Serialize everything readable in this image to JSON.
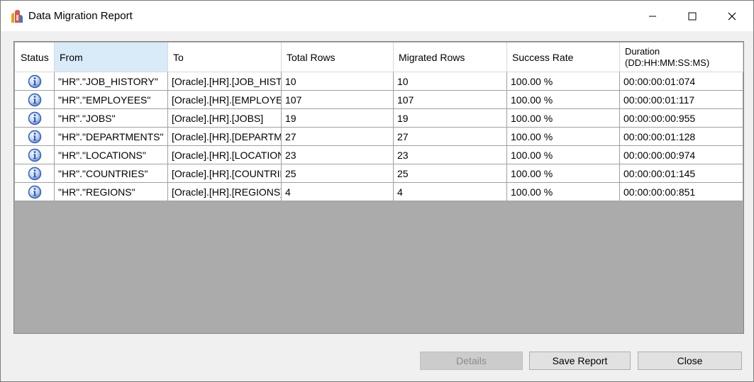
{
  "window": {
    "title": "Data Migration Report",
    "controls": {
      "minimize": "minimize-icon",
      "maximize": "maximize-icon",
      "close": "close-icon"
    }
  },
  "table": {
    "columns": [
      "Status",
      "From",
      "To",
      "Total Rows",
      "Migrated Rows",
      "Success Rate",
      "Duration",
      "(DD:HH:MM:SS:MS)"
    ],
    "rows": [
      {
        "status": "info-icon",
        "from": "\"HR\".\"JOB_HISTORY\"",
        "to": "[Oracle].[HR].[JOB_HISTORY]",
        "total": "10",
        "migrated": "10",
        "rate": "100.00 %",
        "duration": "00:00:00:01:074"
      },
      {
        "status": "info-icon",
        "from": "\"HR\".\"EMPLOYEES\"",
        "to": "[Oracle].[HR].[EMPLOYEES]",
        "total": "107",
        "migrated": "107",
        "rate": "100.00 %",
        "duration": "00:00:00:01:117"
      },
      {
        "status": "info-icon",
        "from": "\"HR\".\"JOBS\"",
        "to": "[Oracle].[HR].[JOBS]",
        "total": "19",
        "migrated": "19",
        "rate": "100.00 %",
        "duration": "00:00:00:00:955"
      },
      {
        "status": "info-icon",
        "from": "\"HR\".\"DEPARTMENTS\"",
        "to": "[Oracle].[HR].[DEPARTMENTS]",
        "total": "27",
        "migrated": "27",
        "rate": "100.00 %",
        "duration": "00:00:00:01:128"
      },
      {
        "status": "info-icon",
        "from": "\"HR\".\"LOCATIONS\"",
        "to": "[Oracle].[HR].[LOCATIONS]",
        "total": "23",
        "migrated": "23",
        "rate": "100.00 %",
        "duration": "00:00:00:00:974"
      },
      {
        "status": "info-icon",
        "from": "\"HR\".\"COUNTRIES\"",
        "to": "[Oracle].[HR].[COUNTRIES]",
        "total": "25",
        "migrated": "25",
        "rate": "100.00 %",
        "duration": "00:00:00:01:145"
      },
      {
        "status": "info-icon",
        "from": "\"HR\".\"REGIONS\"",
        "to": "[Oracle].[HR].[REGIONS]",
        "total": "4",
        "migrated": "4",
        "rate": "100.00 %",
        "duration": "00:00:00:00:851"
      }
    ],
    "selected_header": "From"
  },
  "buttons": {
    "details": "Details",
    "save_report": "Save Report",
    "close": "Close"
  },
  "colors": {
    "grid_background": "#ababab",
    "header_selected": "#d9ebf9",
    "info_icon": "#2a5cc4"
  }
}
